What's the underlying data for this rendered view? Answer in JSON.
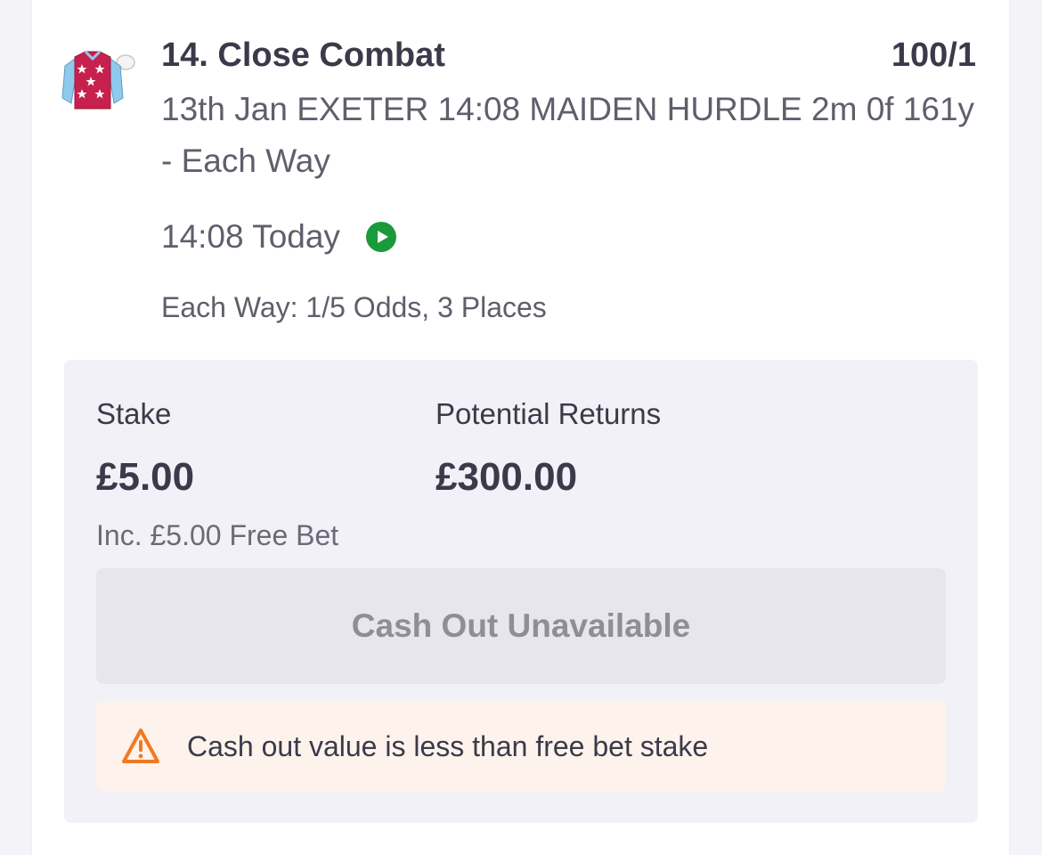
{
  "selection": {
    "title": "14. Close Combat",
    "odds": "100/1",
    "market": "13th Jan EXETER 14:08 MAIDEN HURDLE 2m 0f 161y - Each Way",
    "time": "14:08 Today",
    "each_way_terms": "Each Way: 1/5 Odds, 3 Places",
    "silks_icon": "jockey-silks-icon",
    "silks_colors": {
      "body": "#c8204e",
      "sleeves": "#8fc9ee",
      "stars": "#ffffff"
    },
    "live_icon": "play-circle-icon",
    "live_color": "#1a9a3a"
  },
  "bet": {
    "stake_label": "Stake",
    "stake_value": "£5.00",
    "returns_label": "Potential Returns",
    "returns_value": "£300.00",
    "free_bet_note": "Inc. £5.00 Free Bet",
    "cashout_label": "Cash Out Unavailable",
    "warning_text": "Cash out value is less than free bet stake",
    "warning_icon": "warning-triangle-icon",
    "warning_color": "#f07a22"
  }
}
